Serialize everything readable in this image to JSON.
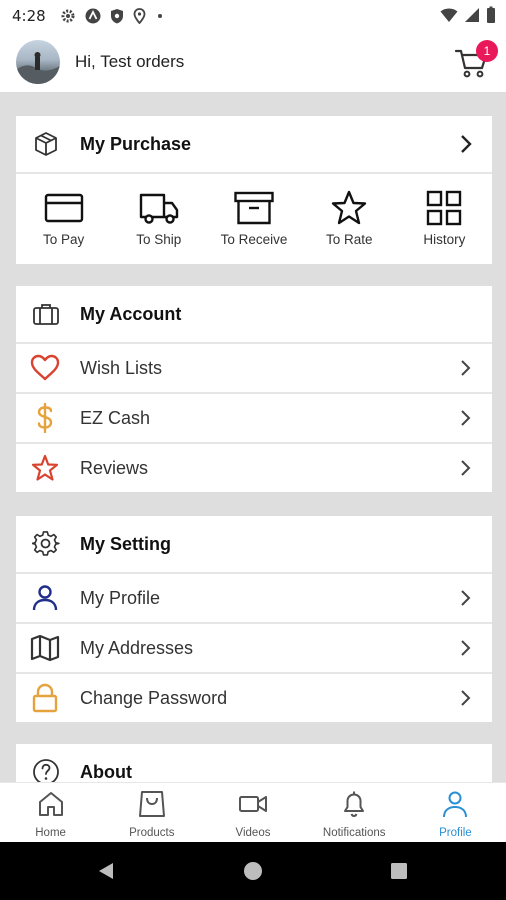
{
  "status_bar": {
    "time": "4:28"
  },
  "header": {
    "greeting": "Hi, Test orders",
    "cart_badge": "1"
  },
  "purchase": {
    "title": "My Purchase",
    "items": [
      {
        "label": "To Pay",
        "icon": "credit-card-icon"
      },
      {
        "label": "To Ship",
        "icon": "truck-icon"
      },
      {
        "label": "To Receive",
        "icon": "archive-box-icon"
      },
      {
        "label": "To Rate",
        "icon": "star-icon"
      },
      {
        "label": "History",
        "icon": "grid-icon"
      }
    ]
  },
  "account": {
    "title": "My Account",
    "items": [
      {
        "label": "Wish Lists",
        "icon": "heart-icon",
        "color": "#d9432f"
      },
      {
        "label": "EZ Cash",
        "icon": "dollar-icon",
        "color": "#e6a23c"
      },
      {
        "label": "Reviews",
        "icon": "star-icon",
        "color": "#d9432f"
      }
    ]
  },
  "settings": {
    "title": "My Setting",
    "items": [
      {
        "label": "My Profile",
        "icon": "user-icon",
        "color": "#1f2f8a"
      },
      {
        "label": "My Addresses",
        "icon": "map-icon",
        "color": "#333333"
      },
      {
        "label": "Change Password",
        "icon": "lock-icon",
        "color": "#e6a23c"
      }
    ]
  },
  "about": {
    "title": "About"
  },
  "bottom_nav": {
    "items": [
      {
        "label": "Home",
        "icon": "home-icon"
      },
      {
        "label": "Products",
        "icon": "shopping-bag-icon"
      },
      {
        "label": "Videos",
        "icon": "video-camera-icon"
      },
      {
        "label": "Notifications",
        "icon": "bell-icon"
      },
      {
        "label": "Profile",
        "icon": "user-icon",
        "active": true
      }
    ],
    "active_color": "#2a8fd4"
  }
}
